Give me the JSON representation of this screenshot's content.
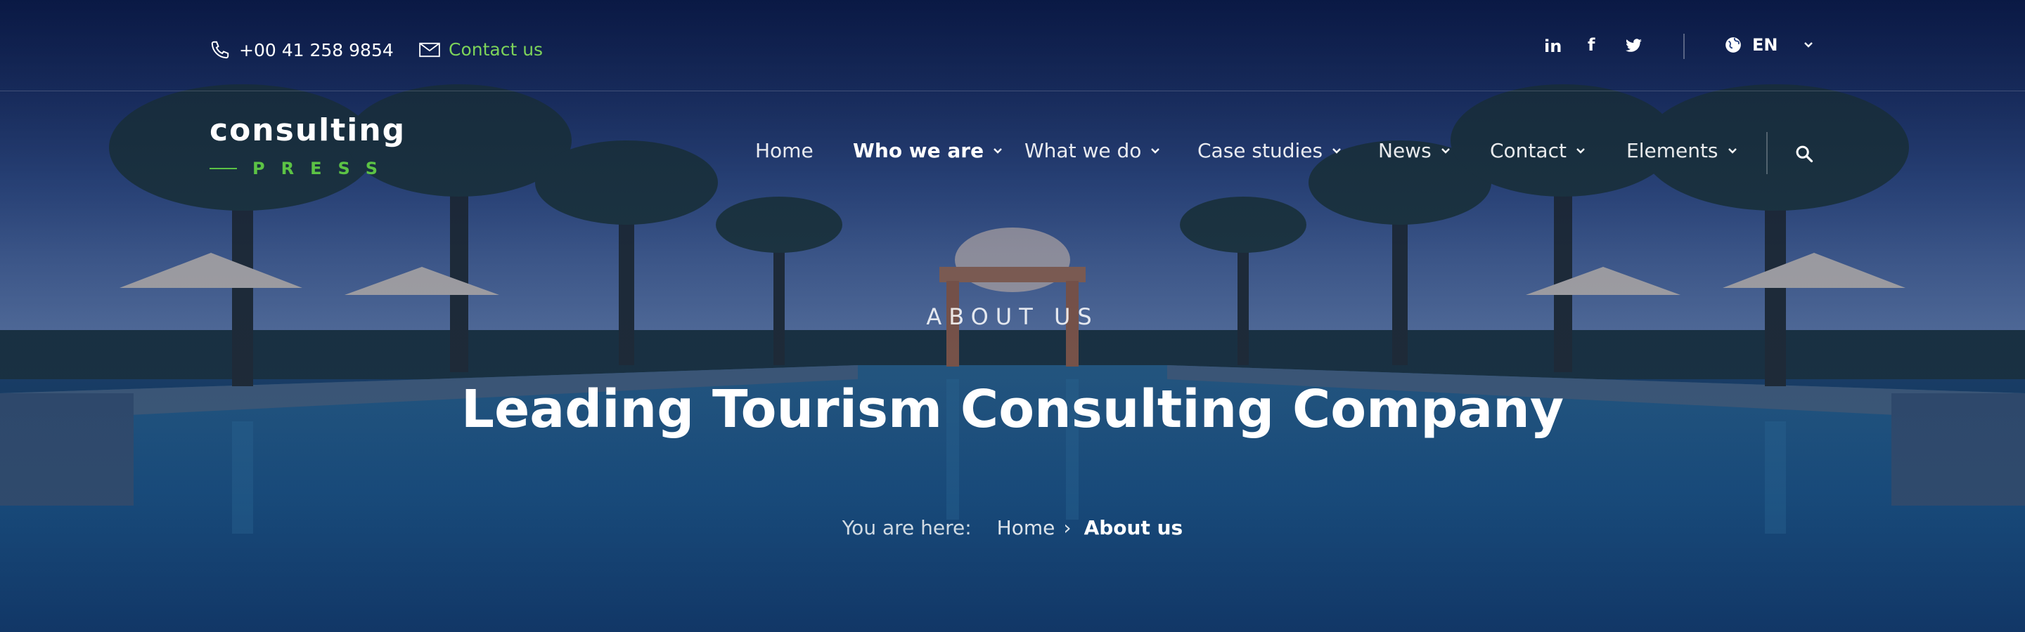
{
  "topbar": {
    "phone": "+00 41 258 9854",
    "contact": "Contact us",
    "social": [
      "in",
      "f",
      "twitter"
    ],
    "language": "EN"
  },
  "logo": {
    "main": "consulting",
    "sub": "PRESS"
  },
  "nav": {
    "items": [
      {
        "label": "Home",
        "dropdown": false
      },
      {
        "label": "Who we are",
        "dropdown": true,
        "active": true
      },
      {
        "label": "What we do",
        "dropdown": true
      },
      {
        "label": "Case studies",
        "dropdown": true
      },
      {
        "label": "News",
        "dropdown": true
      },
      {
        "label": "Contact",
        "dropdown": true
      },
      {
        "label": "Elements",
        "dropdown": true
      }
    ]
  },
  "hero": {
    "eyebrow": "ABOUT US",
    "title": "Leading Tourism Consulting Company",
    "breadcrumb": {
      "label": "You are here:",
      "home": "Home",
      "separator": "›",
      "current": "About us"
    }
  },
  "colors": {
    "accent": "#5cc345",
    "contact": "#7dd35a",
    "navy": "#0b1c4a"
  },
  "icons": [
    "phone-icon",
    "mail-icon",
    "linkedin-icon",
    "facebook-icon",
    "twitter-icon",
    "globe-icon",
    "chevron-down-icon",
    "search-icon"
  ]
}
